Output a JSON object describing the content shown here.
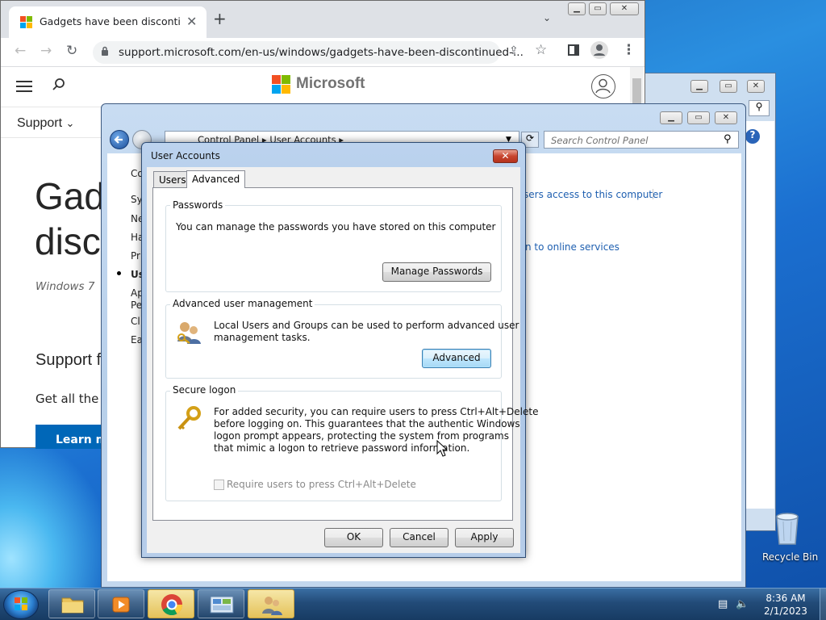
{
  "browser": {
    "tab_title": "Gadgets have been discontinued",
    "url": "support.microsoft.com/en-us/windows/gadgets-have-been-discontinued-...",
    "brand": "Microsoft",
    "nav_support": "Support",
    "page_title_line1": "Gad",
    "page_title_line2": "disc",
    "page_subtitle": "Windows 7",
    "section_heading": "Support f",
    "paragraph": "Get all the f",
    "cta": "Learn m"
  },
  "control_panel": {
    "breadcrumb": "Control Panel  ▸  User Accounts  ▸",
    "search_placeholder": "Search Control Panel",
    "sidebar": [
      "Co",
      "Sy",
      "Ne",
      "Ha",
      "Pr",
      "Us",
      "Ap",
      "Pe",
      "Cl",
      "Ea"
    ],
    "link_1": "sers access to this computer",
    "link_2": "n to online services"
  },
  "dialog": {
    "title": "User Accounts",
    "tabs": [
      "Users",
      "Advanced"
    ],
    "passwords": {
      "label": "Passwords",
      "text": "You can manage the passwords you have stored on this computer",
      "button": "Manage Passwords"
    },
    "advanced_mgmt": {
      "label": "Advanced user management",
      "text_1": "Local Users and Groups can be used to perform advanced user",
      "text_2": "management tasks.",
      "button": "Advanced"
    },
    "secure_logon": {
      "label": "Secure logon",
      "text_1": "For added security, you can require users to press Ctrl+Alt+Delete",
      "text_2": "before logging on. This guarantees that the authentic Windows",
      "text_3": "logon prompt appears, protecting the system from programs",
      "text_4": "that mimic a logon to retrieve password information.",
      "checkbox": "Require users to press Ctrl+Alt+Delete"
    },
    "buttons": {
      "ok": "OK",
      "cancel": "Cancel",
      "apply": "Apply"
    }
  },
  "desktop": {
    "recycle_bin": "Recycle Bin"
  },
  "taskbar": {
    "time": "8:36 AM",
    "date": "2/1/2023"
  }
}
